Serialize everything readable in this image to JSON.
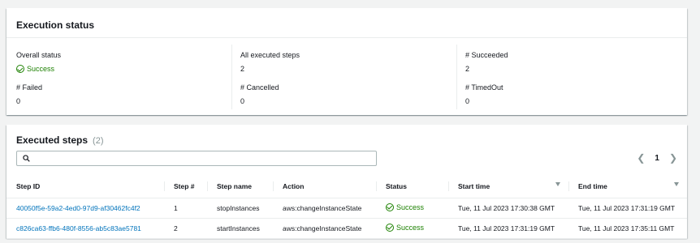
{
  "execution_status": {
    "title": "Execution status",
    "overall_status_label": "Overall status",
    "overall_status_value": "Success",
    "all_steps_label": "All executed steps",
    "all_steps_value": "2",
    "succeeded_label": "# Succeeded",
    "succeeded_value": "2",
    "failed_label": "# Failed",
    "failed_value": "0",
    "cancelled_label": "# Cancelled",
    "cancelled_value": "0",
    "timedout_label": "# TimedOut",
    "timedout_value": "0"
  },
  "executed_steps": {
    "title": "Executed steps",
    "count": "(2)",
    "search_placeholder": "",
    "current_page": "1",
    "columns": {
      "step_id": "Step ID",
      "step_num": "Step #",
      "step_name": "Step name",
      "action": "Action",
      "status": "Status",
      "start_time": "Start time",
      "end_time": "End time"
    },
    "rows": [
      {
        "step_id": "40050f5e-59a2-4ed0-97d9-af30462fc4f2",
        "step_num": "1",
        "step_name": "stopInstances",
        "action": "aws:changeInstanceState",
        "status": "Success",
        "start_time": "Tue, 11 Jul 2023 17:30:38 GMT",
        "end_time": "Tue, 11 Jul 2023 17:31:19 GMT"
      },
      {
        "step_id": "c826ca63-ffb6-480f-8556-ab5c83ae5781",
        "step_num": "2",
        "step_name": "startInstances",
        "action": "aws:changeInstanceState",
        "status": "Success",
        "start_time": "Tue, 11 Jul 2023 17:31:19 GMT",
        "end_time": "Tue, 11 Jul 2023 17:35:11 GMT"
      }
    ]
  },
  "colors": {
    "success": "#1d8102",
    "link": "#0073bb"
  },
  "icons": {
    "status": "check-circle-icon",
    "search": "search-icon",
    "prev": "chevron-left-icon",
    "next": "chevron-right-icon",
    "sort": "caret-down-icon"
  }
}
